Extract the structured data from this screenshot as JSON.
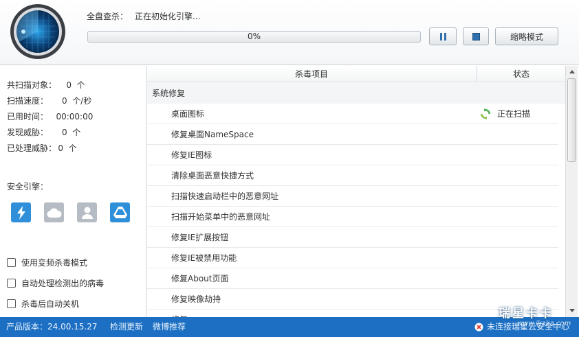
{
  "header": {
    "scan_label": "全盘查杀：",
    "scan_status": "正在初始化引擎...",
    "progress_text": "0%",
    "progress_value": 0,
    "mini_mode_label": "缩略模式",
    "pause_icon": "pause-icon",
    "stop_icon": "stop-icon",
    "logo_icon": "radar-scan-icon"
  },
  "stats": [
    {
      "label": "共扫描对象：",
      "value": "0",
      "unit": "个"
    },
    {
      "label": "扫描速度：",
      "value": "0",
      "unit": "个/秒"
    },
    {
      "label": "已用时间：",
      "value": "00:00:00",
      "unit": ""
    },
    {
      "label": "发现威胁：",
      "value": "0",
      "unit": "个"
    },
    {
      "label": "已处理威胁：",
      "value": "0",
      "unit": "个"
    }
  ],
  "engines": {
    "title": "安全引擎：",
    "items": [
      "lightning-engine-icon",
      "cloud-engine-icon",
      "user-engine-icon",
      "drive-engine-icon"
    ]
  },
  "options": [
    "使用变频杀毒模式",
    "自动处理检测出的病毒",
    "杀毒后自动关机"
  ],
  "table": {
    "col_item": "杀毒项目",
    "col_status": "状态",
    "group": "系统修复",
    "rows": [
      {
        "name": "桌面图标",
        "status": "正在扫描"
      },
      {
        "name": "修复桌面NameSpace",
        "status": ""
      },
      {
        "name": "修复IE图标",
        "status": ""
      },
      {
        "name": "清除桌面恶意快捷方式",
        "status": ""
      },
      {
        "name": "扫描快速启动栏中的恶意网址",
        "status": ""
      },
      {
        "name": "扫描开始菜单中的恶意网址",
        "status": ""
      },
      {
        "name": "修复IE扩展按钮",
        "status": ""
      },
      {
        "name": "修复IE被禁用功能",
        "status": ""
      },
      {
        "name": "修复About页面",
        "status": ""
      },
      {
        "name": "修复映像劫持",
        "status": ""
      },
      {
        "name": "修复…",
        "status": ""
      }
    ]
  },
  "footer": {
    "version": "产品版本：24.00.15.27",
    "check_update": "检测更新",
    "weibo": "微博推荐",
    "cloud_status": "未连接瑞星云安全中心"
  },
  "watermark": {
    "brand": "瑞星卡卡",
    "url": "www.ikaka.com"
  },
  "colors": {
    "footer_bg": "#1c6fc2",
    "engine_blue": "#2f8fd8",
    "engine_gray": "#b5bcc3",
    "scan_green": "#4caf50"
  }
}
